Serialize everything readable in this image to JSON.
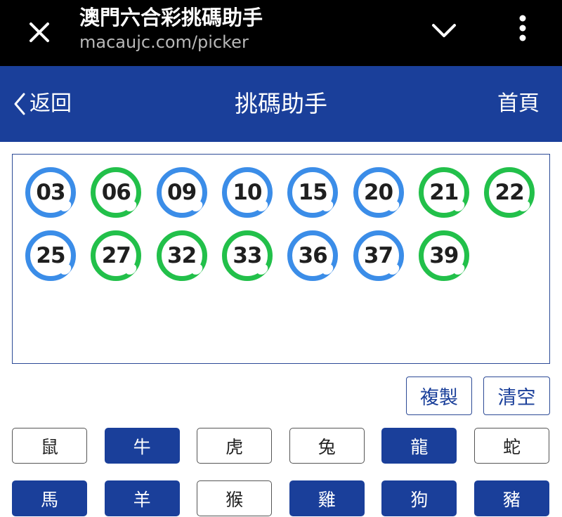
{
  "browser": {
    "title": "澳門六合彩挑碼助手",
    "url": "macaujc.com/picker"
  },
  "header": {
    "back_label": "返回",
    "title": "挑碼助手",
    "home_label": "首頁"
  },
  "colors": {
    "primary": "#1a3f9a",
    "ball_blue": "#3b8de8",
    "ball_green": "#22c04a"
  },
  "balls": [
    {
      "num": "03",
      "color": "blue"
    },
    {
      "num": "06",
      "color": "green"
    },
    {
      "num": "09",
      "color": "blue"
    },
    {
      "num": "10",
      "color": "blue"
    },
    {
      "num": "15",
      "color": "blue"
    },
    {
      "num": "20",
      "color": "blue"
    },
    {
      "num": "21",
      "color": "green"
    },
    {
      "num": "22",
      "color": "green"
    },
    {
      "num": "25",
      "color": "blue"
    },
    {
      "num": "27",
      "color": "green"
    },
    {
      "num": "32",
      "color": "green"
    },
    {
      "num": "33",
      "color": "green"
    },
    {
      "num": "36",
      "color": "blue"
    },
    {
      "num": "37",
      "color": "blue"
    },
    {
      "num": "39",
      "color": "green"
    }
  ],
  "actions": {
    "copy_label": "複製",
    "clear_label": "清空"
  },
  "zodiacs": [
    {
      "label": "鼠",
      "selected": false
    },
    {
      "label": "牛",
      "selected": true
    },
    {
      "label": "虎",
      "selected": false
    },
    {
      "label": "兔",
      "selected": false
    },
    {
      "label": "龍",
      "selected": true
    },
    {
      "label": "蛇",
      "selected": false
    },
    {
      "label": "馬",
      "selected": true
    },
    {
      "label": "羊",
      "selected": true
    },
    {
      "label": "猴",
      "selected": false
    },
    {
      "label": "雞",
      "selected": true
    },
    {
      "label": "狗",
      "selected": true
    },
    {
      "label": "豬",
      "selected": true
    }
  ]
}
